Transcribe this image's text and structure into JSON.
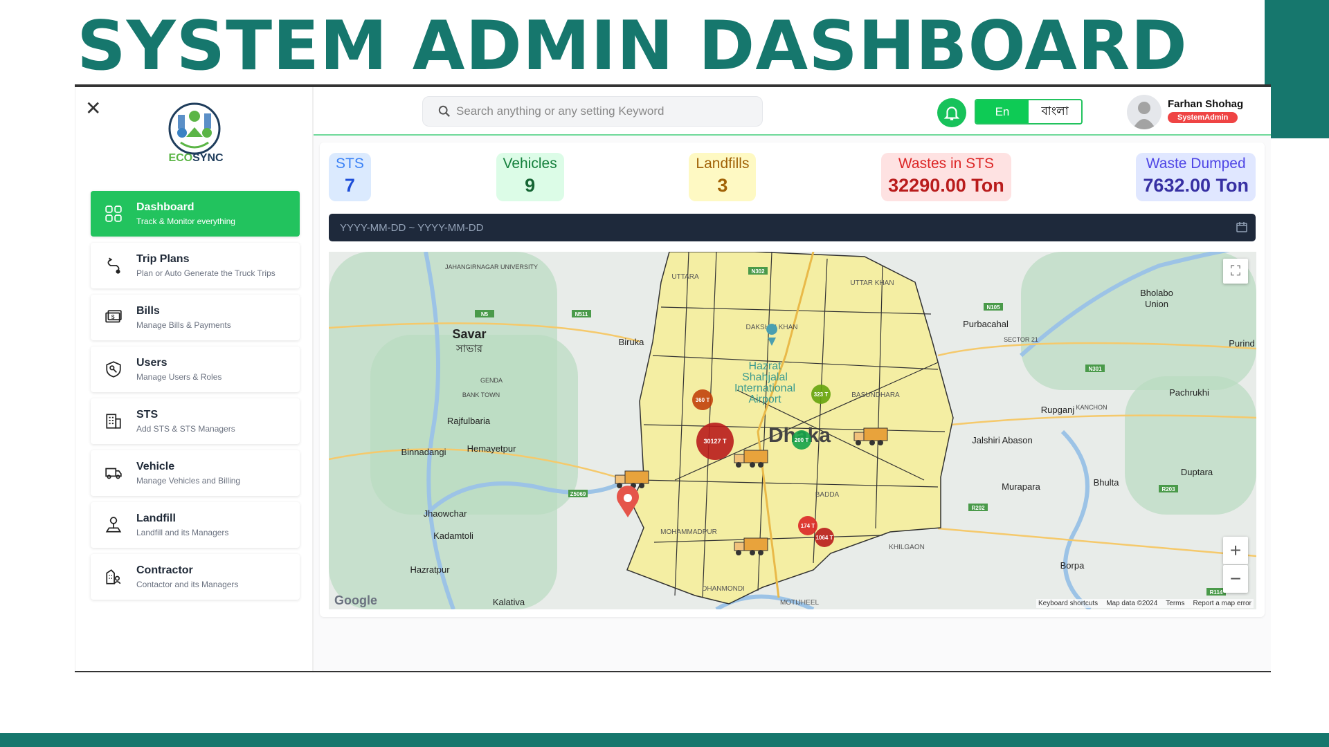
{
  "page_title": "SYSTEM ADMIN DASHBOARD",
  "brand": {
    "part1": "ECO",
    "part2": "SYNC",
    "color1": "#5bb546",
    "color2": "#1f3d5c"
  },
  "sidebar": {
    "items": [
      {
        "label": "Dashboard",
        "sub": "Track & Monitor everything",
        "icon": "grid-icon",
        "active": true
      },
      {
        "label": "Trip Plans",
        "sub": "Plan or Auto Generate the Truck Trips",
        "icon": "route-icon"
      },
      {
        "label": "Bills",
        "sub": "Manage Bills & Payments",
        "icon": "money-icon"
      },
      {
        "label": "Users",
        "sub": "Manage Users & Roles",
        "icon": "shield-key-icon"
      },
      {
        "label": "STS",
        "sub": "Add STS & STS Managers",
        "icon": "building-icon"
      },
      {
        "label": "Vehicle",
        "sub": "Manage Vehicles and Billing",
        "icon": "truck-icon"
      },
      {
        "label": "Landfill",
        "sub": "Landfill and its Managers",
        "icon": "location-pin-icon"
      },
      {
        "label": "Contractor",
        "sub": "Contactor and its Managers",
        "icon": "contractor-icon"
      }
    ]
  },
  "header": {
    "search_placeholder": "Search anything or any setting Keyword",
    "lang_en": "En",
    "lang_bn": "বাংলা",
    "user_name": "Farhan Shohag",
    "user_role": "SystemAdmin"
  },
  "stats": [
    {
      "label": "STS",
      "value": "7",
      "bg": "#dbeafe",
      "fg": "#3b82f6",
      "vfg": "#1d4ed8"
    },
    {
      "label": "Vehicles",
      "value": "9",
      "bg": "#dcfce7",
      "fg": "#15803d",
      "vfg": "#166534"
    },
    {
      "label": "Landfills",
      "value": "3",
      "bg": "#fef9c3",
      "fg": "#a16207",
      "vfg": "#a16207"
    },
    {
      "label": "Wastes in STS",
      "value": "32290.00 Ton",
      "bg": "#fee2e2",
      "fg": "#dc2626",
      "vfg": "#b91c1c"
    },
    {
      "label": "Waste Dumped",
      "value": "7632.00 Ton",
      "bg": "#e0e7ff",
      "fg": "#4f46e5",
      "vfg": "#3730a3"
    }
  ],
  "date_range_placeholder": "YYYY-MM-DD ~ YYYY-MM-DD",
  "map": {
    "places": [
      "Savar",
      "সাভার",
      "Biruka",
      "Purbacahal",
      "Bholabo",
      "Union",
      "Purind",
      "Pachrukhi",
      "Rupganj",
      "Jalshiri Abason",
      "Rajfulbaria",
      "Hemayetpur",
      "Binnadangi",
      "Murapara",
      "Bhulta",
      "Duptara",
      "Jhaowchar",
      "Kadamtoli",
      "Hazratpur",
      "Borpa",
      "Kalativa",
      "Dhaka",
      "Hazrat",
      "Shahjalal",
      "International",
      "Airport",
      "UTTARA",
      "DAKSHIN KHAN",
      "BASUNDHARA",
      "MOHAMMADPUR",
      "BADDA",
      "KHILGAON",
      "DHANMONDI",
      "MOTIJHEEL",
      "UTTAR KHAN",
      "GENDA",
      "BANK TOWN",
      "JAHANGIRNAGAR UNIVERSITY",
      "SECTOR 21",
      "KANCHON"
    ],
    "roads": [
      "N5",
      "N511",
      "N105",
      "N301",
      "N302",
      "Z5069",
      "R202",
      "R203",
      "R114"
    ],
    "markers": [
      {
        "label": "360 T",
        "value": 360,
        "color": "#c2410c"
      },
      {
        "label": "30127 T",
        "value": 30127,
        "color": "#b91c1c"
      },
      {
        "label": "323 T",
        "value": 323,
        "color": "#65a30d"
      },
      {
        "label": "200 T",
        "value": 200,
        "color": "#16a34a"
      },
      {
        "label": "174 T",
        "value": 174,
        "color": "#dc2626"
      },
      {
        "label": "1064 T",
        "value": 1064,
        "color": "#b91c1c"
      }
    ],
    "google": "Google",
    "attribution": [
      "Keyboard shortcuts",
      "Map data ©2024",
      "Terms",
      "Report a map error"
    ],
    "zoom_in": "+",
    "zoom_out": "−"
  }
}
